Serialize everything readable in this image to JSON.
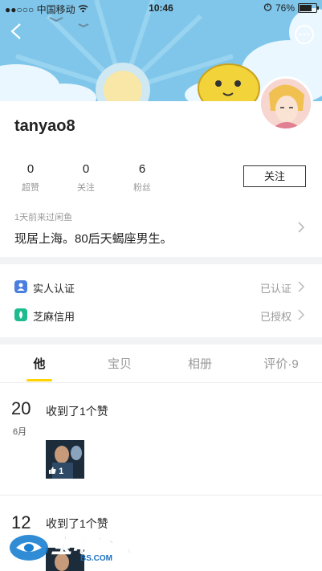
{
  "status_bar": {
    "signal": "●●○○○",
    "carrier": "中国移动",
    "wifi_icon": "wifi-icon",
    "time": "10:46",
    "alarm_icon": "alarm-icon",
    "battery": "76%",
    "battery_level": 0.76
  },
  "nav": {
    "back_icon": "back-icon",
    "more_icon": "more-icon"
  },
  "profile": {
    "username": "tanyao8",
    "stats": [
      {
        "value": "0",
        "label": "超赞"
      },
      {
        "value": "0",
        "label": "关注"
      },
      {
        "value": "6",
        "label": "粉丝"
      }
    ],
    "follow_label": "关注",
    "last_visit": "1天前来过闲鱼",
    "bio": "现居上海。80后天蝎座男生。"
  },
  "verifications": [
    {
      "label": "实人认证",
      "status": "已认证",
      "icon": "id-verify-icon",
      "color": "#4a7fe0"
    },
    {
      "label": "芝麻信用",
      "status": "已授权",
      "icon": "sesame-credit-icon",
      "color": "#1dbb8e"
    }
  ],
  "tabs": [
    {
      "label": "他"
    },
    {
      "label": "宝贝"
    },
    {
      "label": "相册"
    },
    {
      "label": "评价·9"
    }
  ],
  "feed": [
    {
      "day": "20",
      "month": "6月",
      "title": "收到了1个赞",
      "likes": "1"
    },
    {
      "day": "12",
      "month": "",
      "title": "收到了1个赞",
      "likes": ""
    }
  ],
  "watermark": {
    "text": "宝电论坛",
    "sub": "BS.COM"
  },
  "accent_color": "#ffd400"
}
